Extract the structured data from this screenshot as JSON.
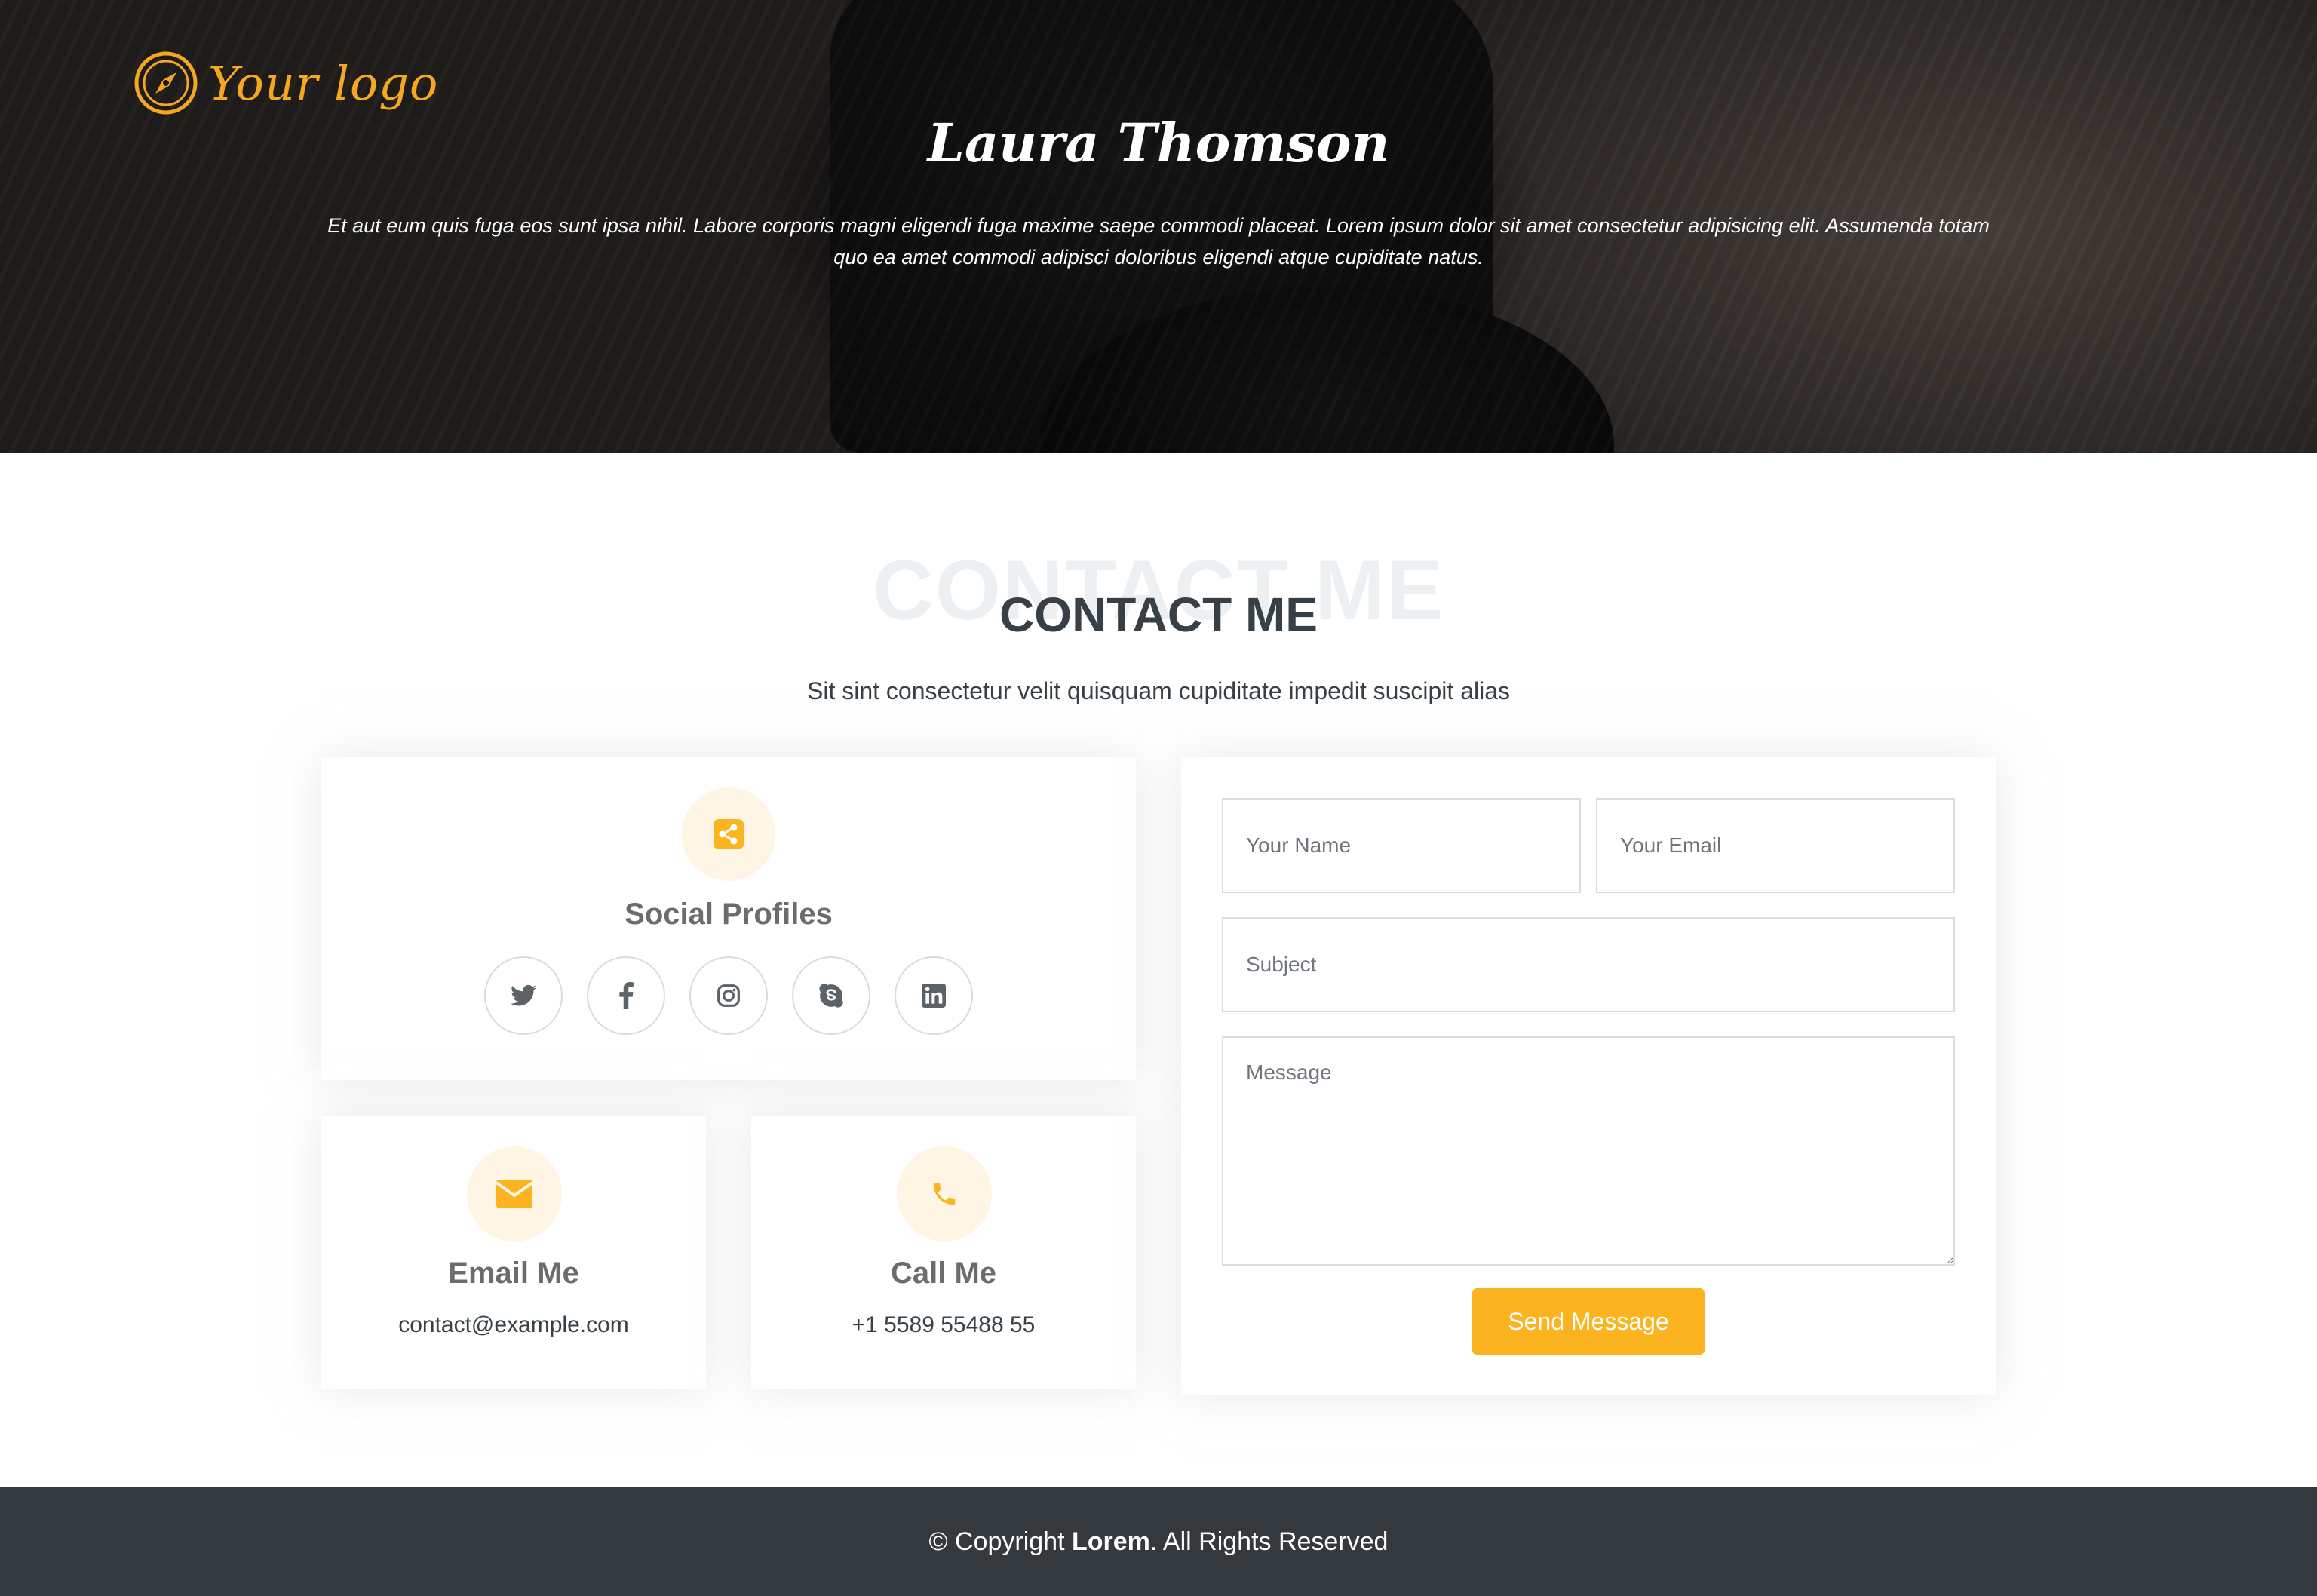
{
  "header": {
    "logo_text": "Your logo",
    "title": "Laura Thomson",
    "description": "Et aut eum quis fuga eos sunt ipsa nihil. Labore corporis magni eligendi fuga maxime saepe commodi placeat. Lorem ipsum dolor sit amet consectetur adipisicing elit. Assumenda totam quo ea amet commodi adipisci doloribus eligendi atque cupiditate natus."
  },
  "contact": {
    "title_bg": "CONTACT ME",
    "title": "CONTACT ME",
    "subtitle": "Sit sint consectetur velit quisquam cupiditate impedit suscipit alias",
    "social": {
      "heading": "Social Profiles",
      "icon": "share-icon",
      "links": [
        {
          "name": "twitter-icon"
        },
        {
          "name": "facebook-icon"
        },
        {
          "name": "instagram-icon"
        },
        {
          "name": "skype-icon"
        },
        {
          "name": "linkedin-icon"
        }
      ]
    },
    "email": {
      "heading": "Email Me",
      "value": "contact@example.com",
      "icon": "envelope-icon"
    },
    "call": {
      "heading": "Call Me",
      "value": "+1 5589 55488 55",
      "icon": "phone-icon"
    },
    "form": {
      "name_placeholder": "Your Name",
      "email_placeholder": "Your Email",
      "subject_placeholder": "Subject",
      "message_placeholder": "Message",
      "submit_label": "Send Message"
    }
  },
  "footer": {
    "prefix": "© Copyright ",
    "brand": "Lorem",
    "suffix": ". All Rights Reserved"
  },
  "colors": {
    "accent": "#fbb41f",
    "logo": "#f5a623",
    "dark": "#374046",
    "footer_bg": "#33393d"
  }
}
